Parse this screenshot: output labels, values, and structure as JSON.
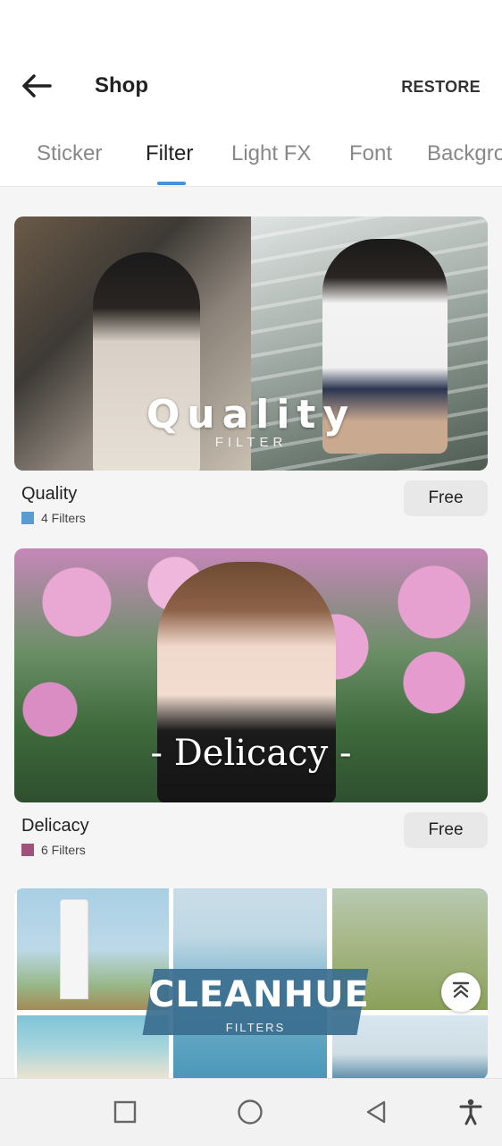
{
  "header": {
    "title": "Shop",
    "restore_label": "RESTORE",
    "back_icon": "arrow-left-icon"
  },
  "tabs": [
    {
      "label": "Sticker",
      "active": false
    },
    {
      "label": "Filter",
      "active": true
    },
    {
      "label": "Light FX",
      "active": false
    },
    {
      "label": "Font",
      "active": false
    },
    {
      "label": "Backgro",
      "active": false
    }
  ],
  "accent_color": "#4a90d9",
  "items": [
    {
      "name": "Quality",
      "count_label": "4 Filters",
      "swatch_color": "#5a9bd0",
      "price_label": "Free",
      "banner_title": "Quality",
      "banner_subtitle": "FILTER"
    },
    {
      "name": "Delicacy",
      "count_label": "6 Filters",
      "swatch_color": "#a0527a",
      "price_label": "Free",
      "banner_title": "- Delicacy -"
    },
    {
      "banner_title": "CLEANHUE",
      "banner_subtitle": "FILTERS"
    }
  ],
  "scroll_top_icon": "chevron-up-double-icon",
  "nav": {
    "recents_icon": "square-icon",
    "home_icon": "circle-icon",
    "back_icon": "triangle-back-icon",
    "accessibility_icon": "accessibility-icon"
  }
}
